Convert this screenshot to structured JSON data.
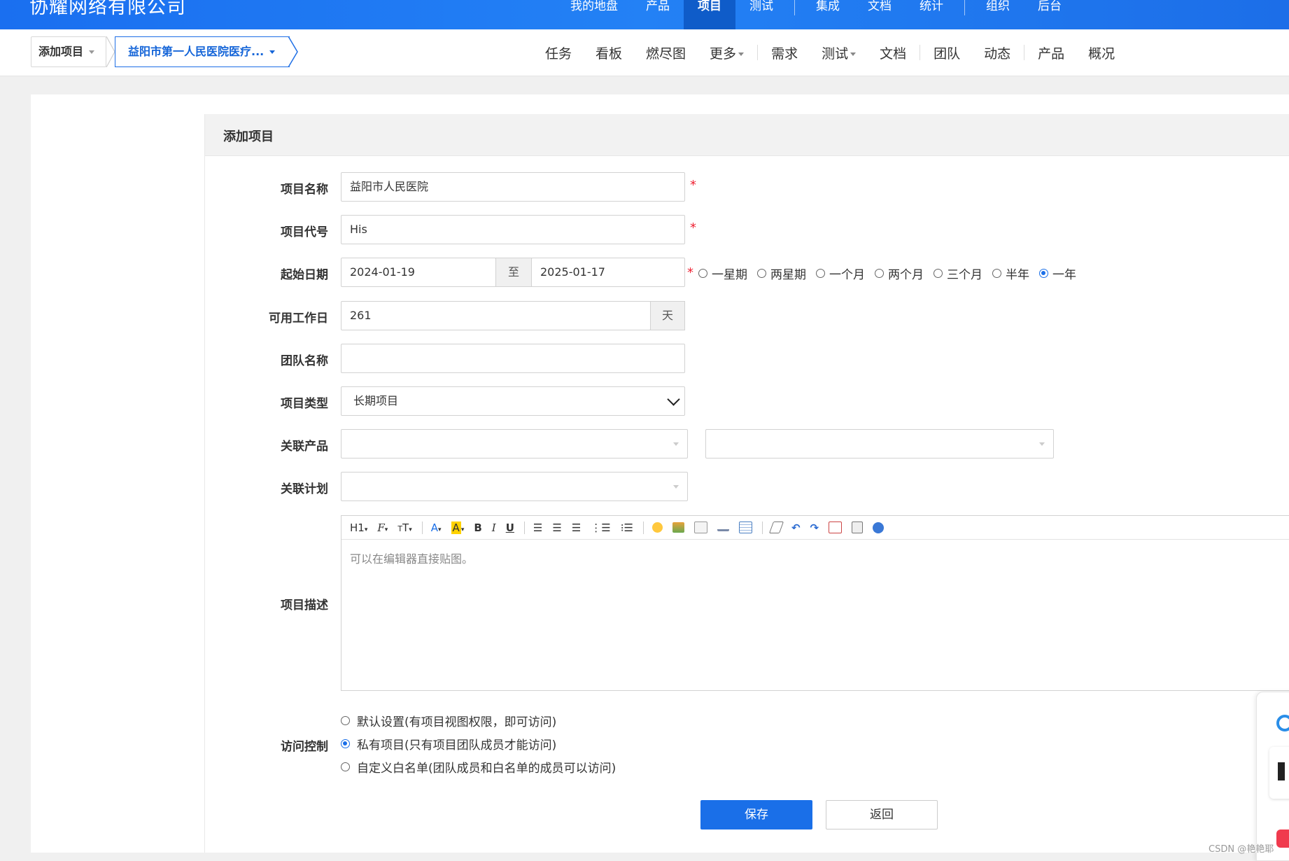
{
  "topbar": {
    "brand": "协耀网络有限公司",
    "nav": [
      {
        "label": "我的地盘"
      },
      {
        "label": "产品"
      },
      {
        "label": "项目",
        "active": true
      },
      {
        "label": "测试"
      },
      {
        "label": "集成"
      },
      {
        "label": "文档"
      },
      {
        "label": "统计"
      },
      {
        "label": "组织"
      },
      {
        "label": "后台"
      }
    ]
  },
  "breadcrumb": {
    "first": "添加项目",
    "second": "益阳市第一人民医院医疗..."
  },
  "subnav": {
    "items": [
      "任务",
      "看板",
      "燃尽图",
      "更多",
      "需求",
      "测试",
      "文档",
      "团队",
      "动态",
      "产品",
      "概况"
    ]
  },
  "form": {
    "title": "添加项目",
    "name_label": "项目名称",
    "name_value": "益阳市人民医院",
    "code_label": "项目代号",
    "code_value": "His",
    "date_label": "起始日期",
    "date_start": "2024-01-19",
    "date_to": "至",
    "date_end": "2025-01-17",
    "quick_ranges": [
      {
        "label": "一星期",
        "checked": false
      },
      {
        "label": "两星期",
        "checked": false
      },
      {
        "label": "一个月",
        "checked": false
      },
      {
        "label": "两个月",
        "checked": false
      },
      {
        "label": "三个月",
        "checked": false
      },
      {
        "label": "半年",
        "checked": false
      },
      {
        "label": "一年",
        "checked": true
      }
    ],
    "days_label": "可用工作日",
    "days_value": "261",
    "days_unit": "天",
    "team_label": "团队名称",
    "team_value": "",
    "type_label": "项目类型",
    "type_value": "长期项目",
    "product_label": "关联产品",
    "plan_label": "关联计划",
    "desc_label": "项目描述",
    "desc_placeholder": "可以在编辑器直接贴图。",
    "toolbar": {
      "h1": "H1",
      "font": "F",
      "size": "T",
      "color": "A",
      "bgcolor": "A",
      "bold": "B",
      "italic": "I",
      "underline": "U"
    },
    "acl_label": "访问控制",
    "acl_options": [
      {
        "label": "默认设置(有项目视图权限，即可访问)",
        "checked": false
      },
      {
        "label": "私有项目(只有项目团队成员才能访问)",
        "checked": true
      },
      {
        "label": "自定义白名单(团队成员和白名单的成员可以访问)",
        "checked": false
      }
    ],
    "save": "保存",
    "back": "返回"
  },
  "watermark": "CSDN @艳艳耶",
  "colors": {
    "primary": "#1a6fe8",
    "topbar": "#2381f5",
    "required": "#ee2233"
  }
}
